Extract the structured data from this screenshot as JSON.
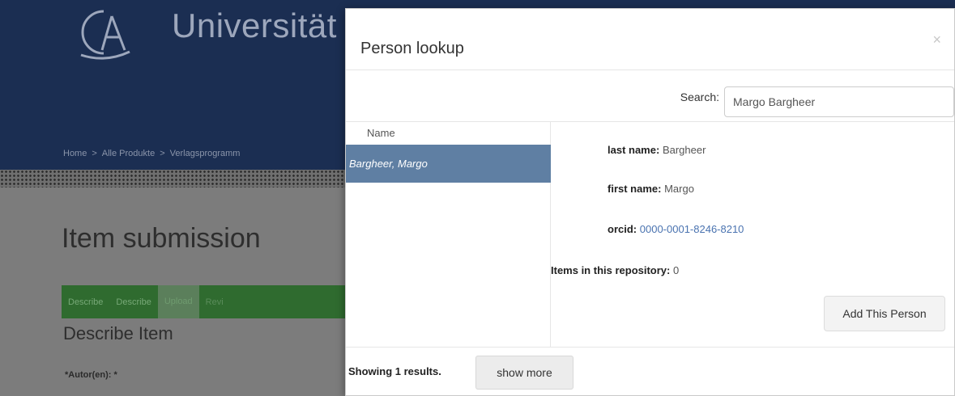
{
  "background": {
    "site_title": "Universität",
    "breadcrumb": [
      "Home",
      "Alle Produkte",
      "Verlagsprogramm"
    ],
    "breadcrumb_separator": ">",
    "page_title": "Item submission",
    "steps": [
      "Describe",
      "Describe",
      "Upload",
      "Revi"
    ],
    "section_title": "Describe Item",
    "field_label": "*Autor(en): *"
  },
  "modal": {
    "title": "Person lookup",
    "close_glyph": "×",
    "search_label": "Search:",
    "search_value": "Margo Bargheer",
    "column_header": "Name",
    "results": [
      {
        "name": "Bargheer, Margo"
      }
    ],
    "details": {
      "last_name_label": "last name:",
      "last_name_value": "Bargheer",
      "first_name_label": "first name:",
      "first_name_value": "Margo",
      "orcid_label": "orcid:",
      "orcid_value": "0000-0001-8246-8210",
      "items_label": "Items in this repository:",
      "items_value": "0"
    },
    "add_button": "Add This Person",
    "showing_text": "Showing 1 results.",
    "show_more_button": "show more"
  },
  "colors": {
    "header_bg": "#1b2e52",
    "selected_row": "#5f7fa3",
    "orcid_link": "#4a73b0",
    "steps_bar": "#2f6b2f"
  }
}
